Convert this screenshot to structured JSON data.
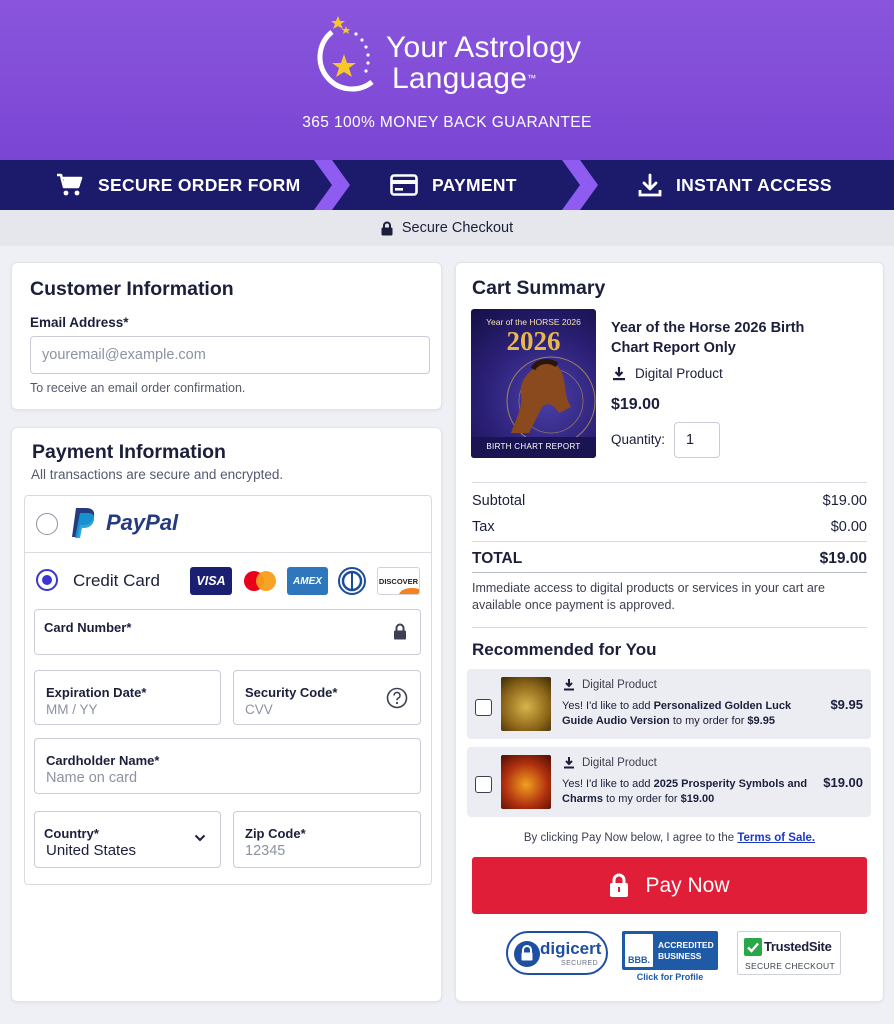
{
  "brand": {
    "line1": "Your Astrology",
    "line2": "Language",
    "tm": "™",
    "guarantee": "365 100% MONEY BACK GUARANTEE"
  },
  "steps": [
    {
      "label": "SECURE ORDER FORM",
      "icon": "cart-icon"
    },
    {
      "label": "PAYMENT",
      "icon": "credit-card-icon"
    },
    {
      "label": "INSTANT ACCESS",
      "icon": "download-icon"
    }
  ],
  "secure_checkout": "Secure Checkout",
  "customer": {
    "title": "Customer Information",
    "email_label": "Email Address*",
    "email_placeholder": "youremail@example.com",
    "email_hint": "To receive an email order confirmation."
  },
  "payment": {
    "title": "Payment Information",
    "subtitle": "All transactions are secure and encrypted.",
    "paypal_label": "PayPal",
    "credit_card_label": "Credit Card",
    "selected_method": "Credit Card",
    "card_brands": [
      "VISA",
      "Mastercard",
      "AMEX",
      "Diners Club",
      "DISCOVER"
    ],
    "card_number_label": "Card Number*",
    "expiry_label": "Expiration Date*",
    "expiry_placeholder": "MM / YY",
    "cvc_label": "Security Code*",
    "cvc_placeholder": "CVV",
    "cardholder_label": "Cardholder Name*",
    "cardholder_placeholder": "Name on card",
    "country_label": "Country*",
    "country_value": "United States",
    "zip_label": "Zip Code*",
    "zip_placeholder": "12345"
  },
  "cart": {
    "title": "Cart Summary",
    "product": {
      "cover_top": "Year of the HORSE 2026",
      "cover_year": "2026",
      "cover_bottom": "BIRTH CHART REPORT",
      "name": "Year of the Horse 2026 Birth Chart Report Only",
      "type": "Digital Product",
      "price": "$19.00",
      "quantity_label": "Quantity:",
      "quantity": "1"
    },
    "subtotal_label": "Subtotal",
    "subtotal": "$19.00",
    "tax_label": "Tax",
    "tax": "$0.00",
    "total_label": "TOTAL",
    "total": "$19.00",
    "note": "Immediate access to digital products or services in your cart are available once payment is approved."
  },
  "recommended": {
    "title": "Recommended for You",
    "items": [
      {
        "type": "Digital Product",
        "pre": "Yes! I'd like to add ",
        "name": "Personalized Golden Luck Guide Audio Version",
        "mid": " to my order for ",
        "for_price": "$9.95",
        "price": "$9.95"
      },
      {
        "type": "Digital Product",
        "pre": "Yes! I'd like to add ",
        "name": "2025 Prosperity Symbols and Charms",
        "mid": " to my order for ",
        "for_price": "$19.00",
        "price": "$19.00"
      }
    ]
  },
  "terms": {
    "pre": "By clicking Pay Now below, I agree to the ",
    "link": "Terms of Sale."
  },
  "pay_now_label": "Pay Now",
  "badges": {
    "digicert": "digicert",
    "digicert_sub": "SECURED",
    "bbb_line1": "ACCREDITED",
    "bbb_line2": "BUSINESS",
    "bbb_link": "Click for Profile",
    "trusted": "TrustedSite",
    "trusted_sub": "SECURE CHECKOUT"
  },
  "colors": {
    "header_purple": "#7f4bd8",
    "steps_navy": "#1c1b6b",
    "chevron": "#8e5cf0",
    "pay_red": "#e01e37",
    "link_blue": "#1a39c4"
  }
}
